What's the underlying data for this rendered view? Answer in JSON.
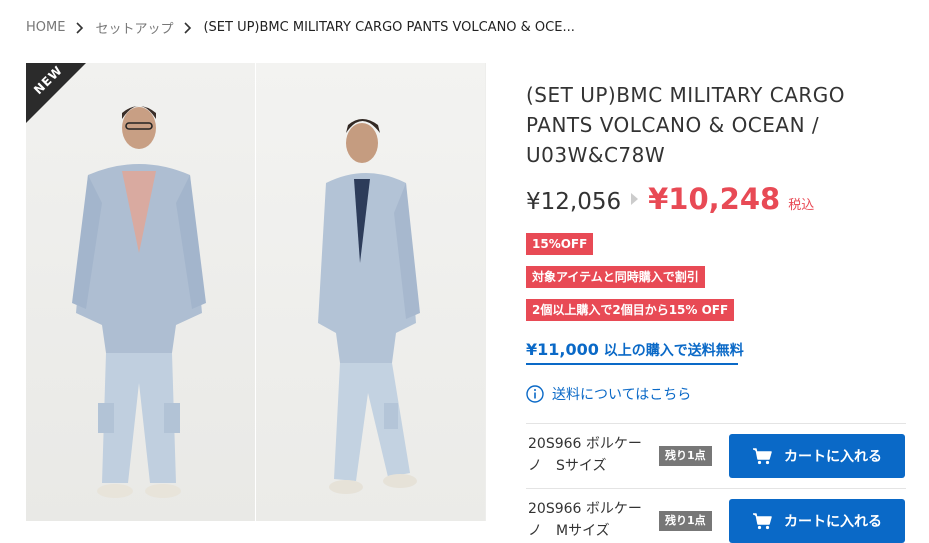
{
  "breadcrumb": {
    "items": [
      "HOME",
      "セットアップ",
      "(SET UP)BMC MILITARY CARGO PANTS VOLCANO & OCE..."
    ]
  },
  "gallery": {
    "badge": "NEW"
  },
  "product": {
    "title": "(SET UP)BMC MILITARY CARGO PANTS VOLCANO & OCEAN / U03W&C78W",
    "original_price": "¥12,056",
    "sale_price": "¥10,248",
    "tax_label": "税込",
    "badges": [
      "15%OFF",
      "対象アイテムと同時購入で割引",
      "2個以上購入で2個目から15% OFF"
    ]
  },
  "shipping": {
    "threshold_amount": "¥11,000",
    "threshold_text": "以上の購入で送料無料",
    "info_link": "送料についてはこちら"
  },
  "variants": [
    {
      "line1": "20S966 ボルケー",
      "line2": "ノ　Sサイズ",
      "stock": "残り1点",
      "button": "カートに入れる"
    },
    {
      "line1": "20S966 ボルケー",
      "line2": "ノ　Mサイズ",
      "stock": "残り1点",
      "button": "カートに入れる"
    }
  ],
  "colors": {
    "accent": "#0a69c7",
    "sale": "#e84a55",
    "stock_badge": "#777777"
  }
}
